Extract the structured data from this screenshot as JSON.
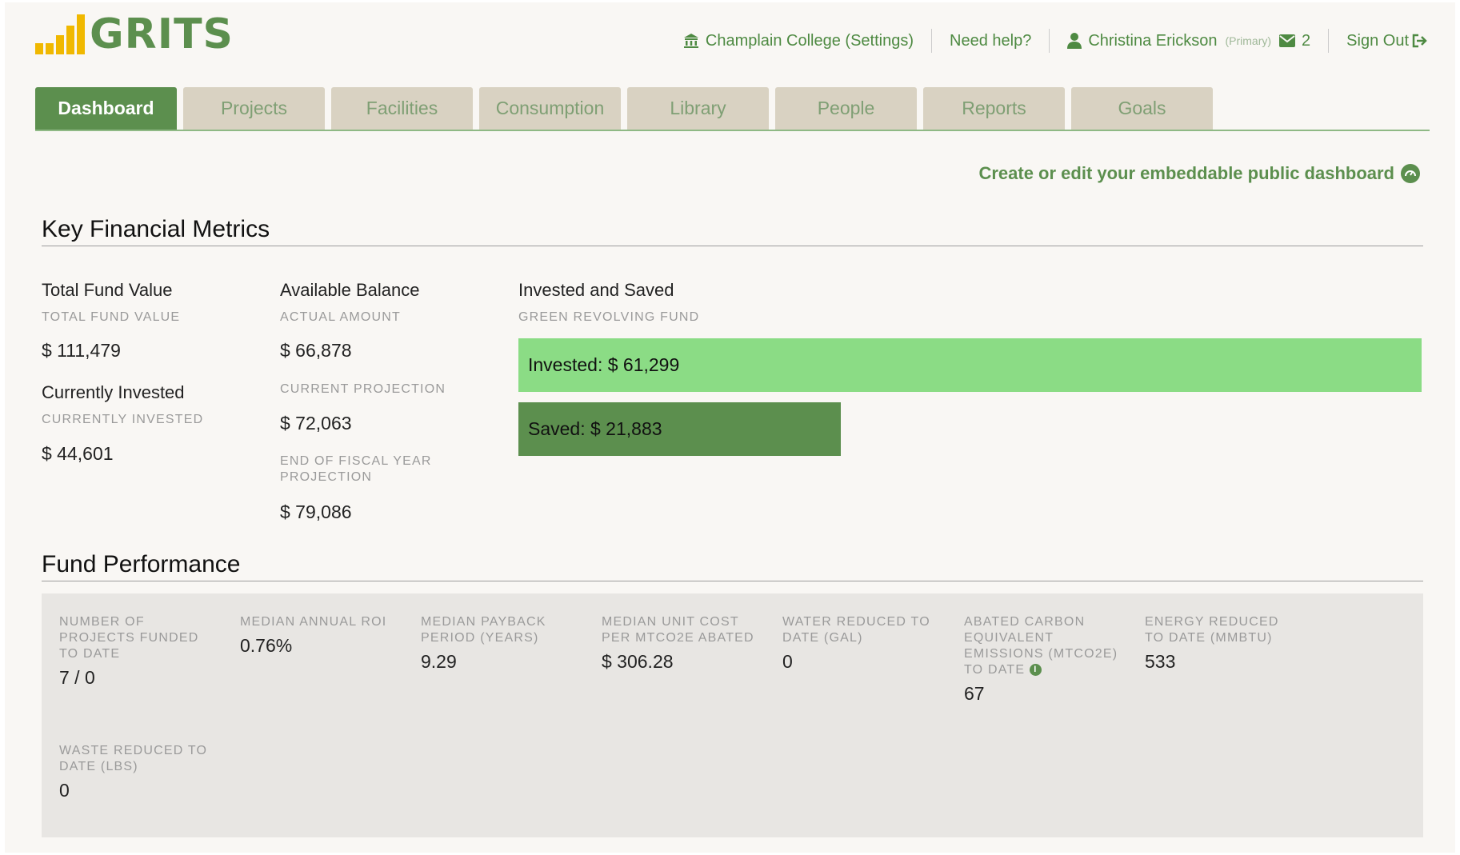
{
  "brand": {
    "name": "GRITS",
    "colors": {
      "green": "#5c8f4e",
      "logo_bar": "#f0b800",
      "invested_bar": "#8bdc85"
    }
  },
  "topnav": {
    "institution": "Champlain College (Settings)",
    "institution_icon": "bank-icon",
    "help": "Need help?",
    "user_name": "Christina Erickson",
    "user_role": "(Primary)",
    "user_icon": "user-icon",
    "mail_icon": "envelope-icon",
    "mail_count": "2",
    "sign_out": "Sign Out",
    "sign_out_icon": "sign-out-icon"
  },
  "tabs": [
    {
      "label": "Dashboard",
      "active": true
    },
    {
      "label": "Projects"
    },
    {
      "label": "Facilities"
    },
    {
      "label": "Consumption"
    },
    {
      "label": "Library"
    },
    {
      "label": "People"
    },
    {
      "label": "Reports"
    },
    {
      "label": "Goals"
    }
  ],
  "embed_link": "Create or edit your embeddable public dashboard",
  "key_metrics": {
    "title": "Key Financial Metrics",
    "total_fund": {
      "label": "Total Fund Value",
      "sub": "TOTAL FUND VALUE",
      "value": "$ 111,479"
    },
    "currently_invested": {
      "label": "Currently Invested",
      "sub": "CURRENTLY INVESTED",
      "value": "$ 44,601"
    },
    "available_balance": {
      "label": "Available Balance",
      "actual_sub": "ACTUAL AMOUNT",
      "actual_value": "$ 66,878",
      "projection_sub": "CURRENT PROJECTION",
      "projection_value": "$ 72,063",
      "fy_sub": "END OF FISCAL YEAR PROJECTION",
      "fy_value": "$ 79,086"
    },
    "invested_saved": {
      "label": "Invested and Saved",
      "sub": "GREEN REVOLVING FUND",
      "invested_text": "Invested: $ 61,299",
      "saved_text": "Saved: $ 21,883",
      "invested_value": 61299,
      "saved_value": 21883
    }
  },
  "fund_performance": {
    "title": "Fund Performance",
    "items": [
      {
        "label": "NUMBER OF PROJECTS FUNDED TO DATE",
        "value": "7 / 0"
      },
      {
        "label": "MEDIAN ANNUAL ROI",
        "value": "0.76%"
      },
      {
        "label": "MEDIAN PAYBACK PERIOD (YEARS)",
        "value": "9.29"
      },
      {
        "label": "MEDIAN UNIT COST PER MTCO2E ABATED",
        "value": "$ 306.28"
      },
      {
        "label": "WATER REDUCED TO DATE (GAL)",
        "value": "0"
      },
      {
        "label": "ABATED CARBON EQUIVALENT EMISSIONS (MTCO2E) TO DATE",
        "value": "67"
      },
      {
        "label": "ENERGY REDUCED TO DATE (MMBTU)",
        "value": "533"
      },
      {
        "label": "WASTE REDUCED TO DATE (LBS)",
        "value": "0"
      }
    ]
  }
}
